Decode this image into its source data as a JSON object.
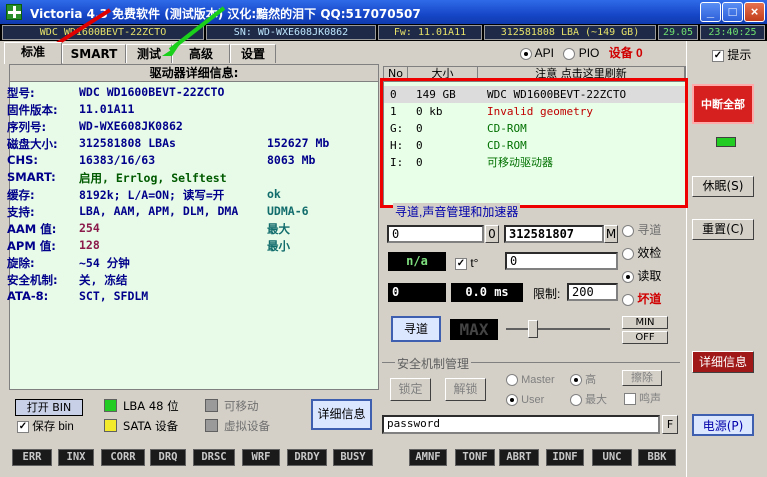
{
  "window": {
    "title": "Victoria 4.3 免费软件 (测试版本) 汉化:黯然的泪下 QQ:517070507"
  },
  "infostrip": {
    "model": "WDC WD1600BEVT-22ZCTO",
    "serial": "SN: WD-WXE608JK0862",
    "firmware": "Fw: 11.01A11",
    "lba": "312581808 LBA (~149 GB)",
    "date": "29.05",
    "time": "23:40:25"
  },
  "tabs": [
    "标准",
    "SMART",
    "测试",
    "高级",
    "设置"
  ],
  "mode": {
    "api_label": "API",
    "pio_label": "PIO",
    "device_label": "设备 0",
    "hint_label": "提示"
  },
  "drive_info": {
    "header": "驱动器详细信息:",
    "rows": [
      {
        "label": "型号:",
        "v1": "WDC WD1600BEVT-22ZCTO",
        "v2": ""
      },
      {
        "label": "固件版本:",
        "v1": "11.01A11",
        "v2": ""
      },
      {
        "label": "序列号:",
        "v1": "WD-WXE608JK0862",
        "v2": ""
      },
      {
        "label": "磁盘大小:",
        "v1": "312581808 LBAs",
        "v2": "152627 Mb"
      },
      {
        "label": "CHS:",
        "v1": "16383/16/63",
        "v2": "8063 Mb"
      },
      {
        "label": "SMART:",
        "v1": "启用, Errlog, Selftest",
        "v2": ""
      },
      {
        "label": "缓存:",
        "v1": "8192k; L/A=ON; 读写=开",
        "v2": "ok"
      },
      {
        "label": "支持:",
        "v1": "LBA, AAM, APM, DLM, DMA",
        "v2": "UDMA-6"
      },
      {
        "label": "AAM 值:",
        "v1": "254",
        "v2": "最大"
      },
      {
        "label": "APM 值:",
        "v1": "128",
        "v2": "最小"
      },
      {
        "label": "旋除:",
        "v1": "~54 分钟",
        "v2": ""
      },
      {
        "label": "安全机制:",
        "v1": "关, 冻结",
        "v2": ""
      },
      {
        "label": "ATA-8:",
        "v1": "SCT, SFDLM",
        "v2": ""
      }
    ]
  },
  "legend": {
    "open_bin": "打开 BIN",
    "save_bin": "保存 bin",
    "lba48": "LBA 48 位",
    "sata": "SATA 设备",
    "removable": "可移动",
    "virtual": "虚拟设备",
    "details_button": "详细信息"
  },
  "drive_table": {
    "headers": [
      "No",
      "大小",
      "注意 点击这里刷新"
    ],
    "rows": [
      {
        "no": "0",
        "size": "149 GB",
        "note": "WDC WD1600BEVT-22ZCTO",
        "color": "#000000"
      },
      {
        "no": "1",
        "size": "0 kb",
        "note": "Invalid geometry",
        "color": "#c00000"
      },
      {
        "no": "G:",
        "size": "0",
        "note": "CD-ROM",
        "color": "#007000"
      },
      {
        "no": "H:",
        "size": "0",
        "note": "CD-ROM",
        "color": "#007000"
      },
      {
        "no": "I:",
        "size": "0",
        "note": "可移动驱动器",
        "color": "#007000"
      }
    ]
  },
  "seek": {
    "label": "寻道,声音管理和加速器",
    "start": "0",
    "start_btn": "0",
    "end": "312581807",
    "end_btn": "M",
    "na": "n/a",
    "temp_label": "t°",
    "temp_value": "0",
    "count": "0",
    "ms": "0.0 ms",
    "limit_label": "限制:",
    "limit_value": "200",
    "seek_btn": "寻道",
    "max_label": "MAX",
    "min_btn": "MIN",
    "off_btn": "OFF",
    "opt_seek": "寻道",
    "opt_verify": "效检",
    "opt_read": "读取",
    "opt_bad": "坏道"
  },
  "security": {
    "label": "安全机制管理",
    "lock": "锁定",
    "unlock": "解锁",
    "master": "Master",
    "user": "User",
    "high": "高",
    "max": "最大",
    "erase": "擦除",
    "beep": "鸣声",
    "password": "password",
    "f_btn": "F"
  },
  "right": {
    "abort": "中断全部",
    "sleep": "休眠(S)",
    "reset": "重置(C)",
    "details": "详细信息",
    "power": "电源(P)"
  },
  "flags": [
    "ERR",
    "INX",
    "CORR",
    "DRQ",
    "DRSC",
    "WRF",
    "DRDY",
    "BUSY",
    "AMNF",
    "TONF",
    "ABRT",
    "IDNF",
    "UNC",
    "BBK"
  ],
  "colors": {
    "abort_bg": "#d61f1f",
    "details_bg": "#a01818"
  }
}
